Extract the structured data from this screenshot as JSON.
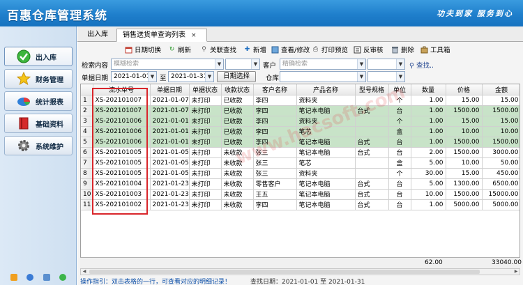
{
  "app": {
    "title": "百惠仓库管理系统",
    "slogan": "功夫到家 服务到心"
  },
  "sidebar": {
    "items": [
      {
        "label": "出入库",
        "icon": "check-circle-icon"
      },
      {
        "label": "财务管理",
        "icon": "star-icon"
      },
      {
        "label": "统计报表",
        "icon": "pie-chart-icon"
      },
      {
        "label": "基础资料",
        "icon": "book-icon"
      },
      {
        "label": "系统维护",
        "icon": "gear-icon"
      }
    ]
  },
  "tabs": [
    {
      "label": "出入库"
    },
    {
      "label": "销售送货单查询列表",
      "close": "×"
    }
  ],
  "toolbar": [
    {
      "label": "日期切换",
      "icon": "calendar-icon"
    },
    {
      "label": "刷新",
      "icon": "refresh-icon"
    },
    {
      "label": "关联查找",
      "icon": "link-search-icon"
    },
    {
      "label": "新增",
      "icon": "add-icon"
    },
    {
      "label": "查看/修改",
      "icon": "edit-icon"
    },
    {
      "label": "打印预览",
      "icon": "print-preview-icon"
    },
    {
      "label": "反审核",
      "icon": "undo-icon"
    },
    {
      "label": "删除",
      "icon": "delete-icon"
    },
    {
      "label": "工具箱",
      "icon": "toolbox-icon"
    }
  ],
  "filter": {
    "search_label": "检索内容",
    "search_placeholder": "模糊检索",
    "customer_label": "客户",
    "customer_placeholder": "精确检索",
    "find_link": "查找..",
    "date_label": "单据日期",
    "date_from": "2021-01-01",
    "to_label": "至",
    "date_to": "2021-01-31",
    "date_select_button": "日期选择",
    "warehouse_label": "仓库"
  },
  "grid": {
    "columns": [
      "",
      "流水单号",
      "单据日期",
      "单据状态",
      "收款状态",
      "客户名称",
      "产品名称",
      "型号规格",
      "单位",
      "数量",
      "价格",
      "金额"
    ],
    "rows": [
      [
        "1",
        "XS-202101007",
        "2021-01-07",
        "未打印",
        "已收款",
        "李四",
        "资料夹",
        "",
        "个",
        "1.00",
        "15.00",
        "15.00"
      ],
      [
        "2",
        "XS-202101007",
        "2021-01-07",
        "未打印",
        "已收款",
        "李四",
        "笔记本电脑",
        "台式",
        "台",
        "1.00",
        "1500.00",
        "1500.00"
      ],
      [
        "3",
        "XS-202101006",
        "2021-01-01",
        "未打印",
        "已收款",
        "李四",
        "资料夹",
        "",
        "个",
        "1.00",
        "15.00",
        "15.00"
      ],
      [
        "4",
        "XS-202101006",
        "2021-01-01",
        "未打印",
        "已收款",
        "李四",
        "笔芯",
        "",
        "盒",
        "1.00",
        "10.00",
        "10.00"
      ],
      [
        "5",
        "XS-202101006",
        "2021-01-01",
        "未打印",
        "已收款",
        "李四",
        "笔记本电脑",
        "台式",
        "台",
        "1.00",
        "1500.00",
        "1500.00"
      ],
      [
        "6",
        "XS-202101005",
        "2021-01-05",
        "未打印",
        "未收款",
        "张三",
        "笔记本电脑",
        "台式",
        "台",
        "2.00",
        "1500.00",
        "3000.00"
      ],
      [
        "7",
        "XS-202101005",
        "2021-01-05",
        "未打印",
        "未收款",
        "张三",
        "笔芯",
        "",
        "盒",
        "5.00",
        "10.00",
        "50.00"
      ],
      [
        "8",
        "XS-202101005",
        "2021-01-05",
        "未打印",
        "未收款",
        "张三",
        "资料夹",
        "",
        "个",
        "30.00",
        "15.00",
        "450.00"
      ],
      [
        "9",
        "XS-202101004",
        "2021-01-23",
        "未打印",
        "未收款",
        "零售客户",
        "笔记本电脑",
        "台式",
        "台",
        "5.00",
        "1300.00",
        "6500.00"
      ],
      [
        "10",
        "XS-202101003",
        "2021-01-23",
        "未打印",
        "未收款",
        "王五",
        "笔记本电脑",
        "台式",
        "台",
        "10.00",
        "1500.00",
        "15000.00"
      ],
      [
        "11",
        "XS-202101002",
        "2021-01-23",
        "未打印",
        "未收款",
        "李四",
        "笔记本电脑",
        "台式",
        "台",
        "1.00",
        "5000.00",
        "5000.00"
      ]
    ],
    "green_rows": [
      2,
      3,
      4,
      5
    ],
    "totals": {
      "qty": "62.00",
      "amount": "33040.00"
    }
  },
  "status": {
    "hint": "操作指引：双击表格的一行，可查看对应的明细记录！",
    "range": "查找日期：2021-01-01 至 2021-01-31"
  },
  "watermark": "www.hacsoft.com",
  "colors": {
    "header": "#1f7fcc",
    "green_row": "#c8e3c8",
    "highlight_box": "#d9262b",
    "hint_text": "#0c4fa8"
  }
}
